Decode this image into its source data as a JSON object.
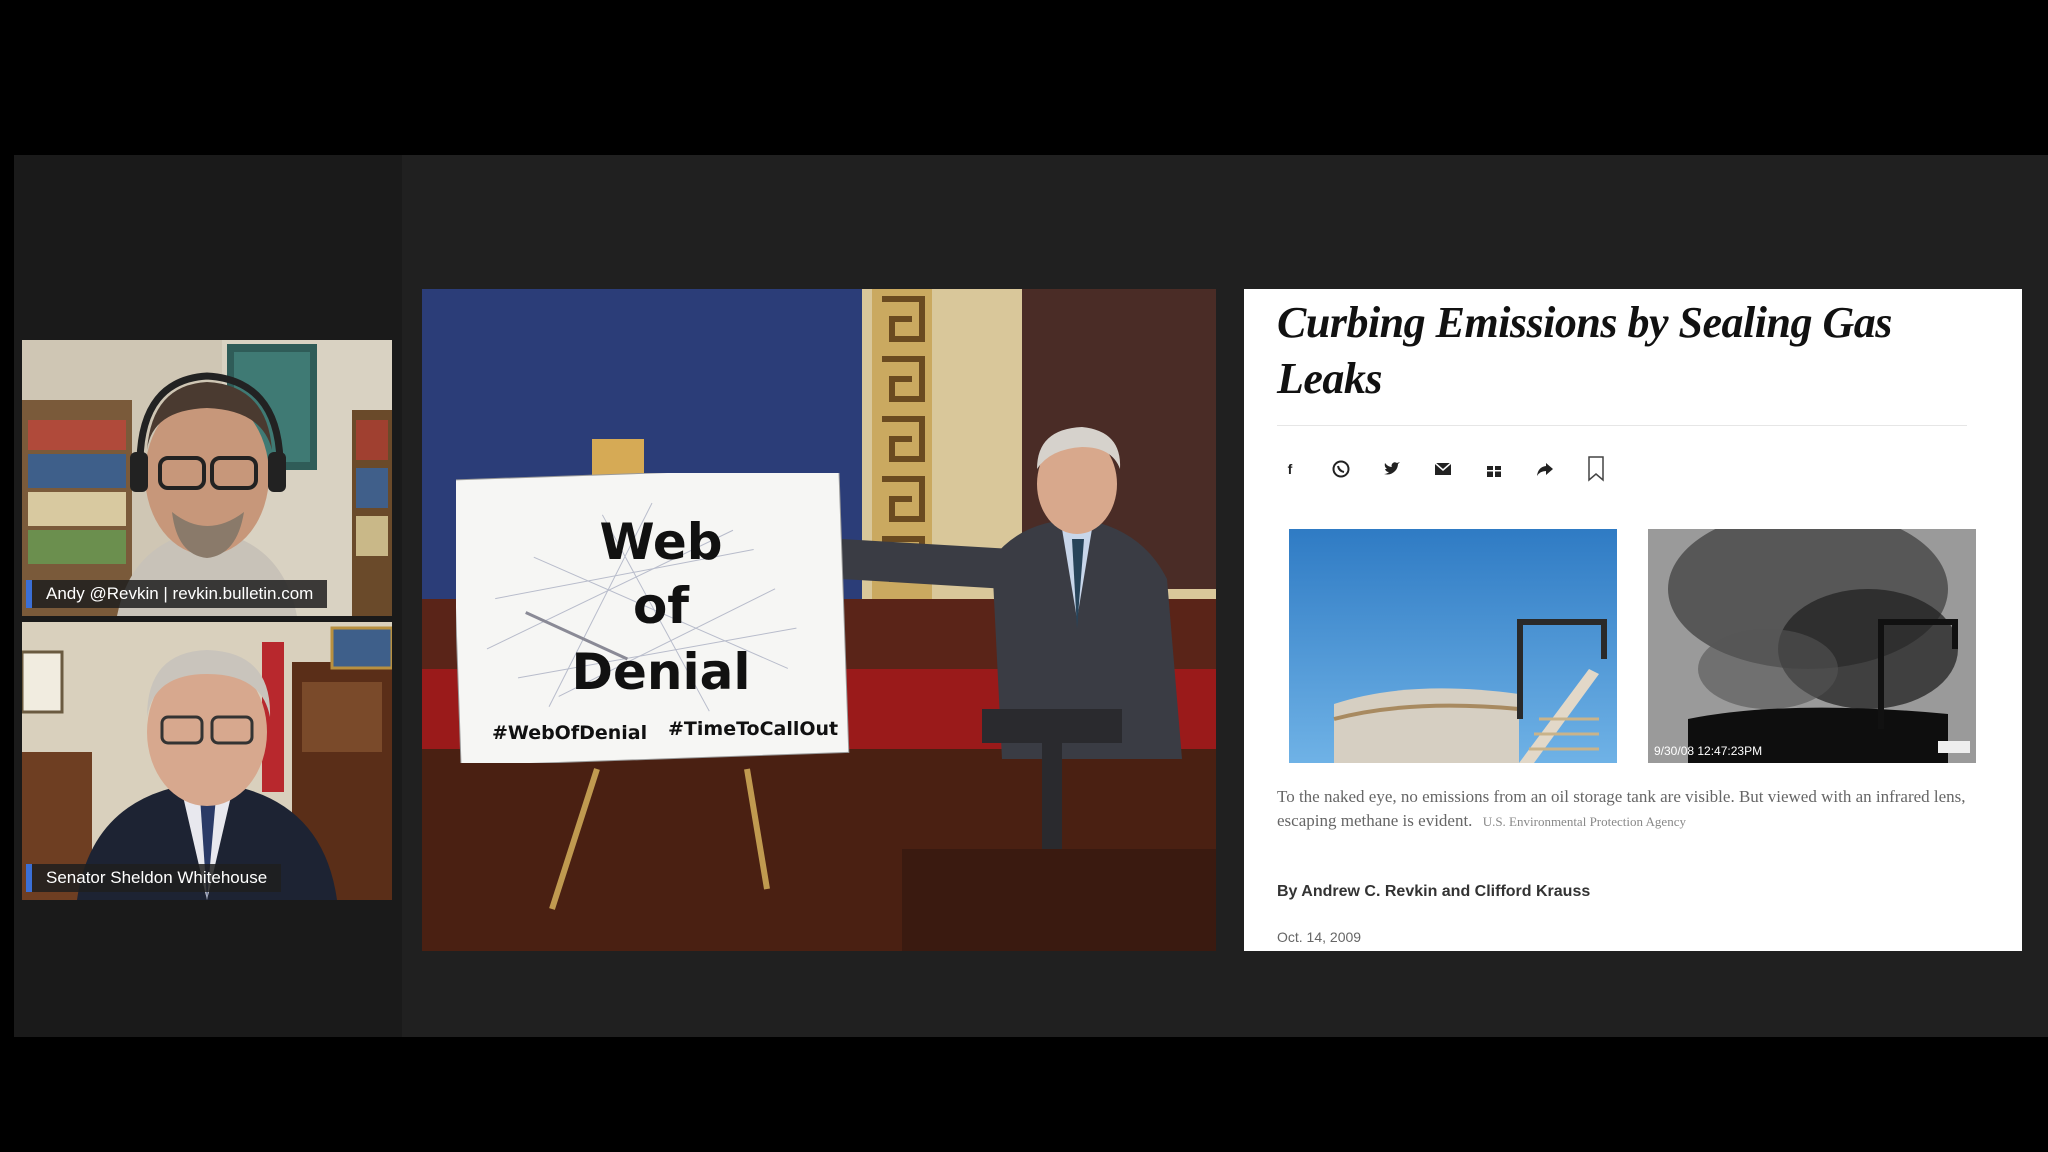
{
  "participants": [
    {
      "name": "Andy @Revkin | revkin.bulletin.com"
    },
    {
      "name": "Senator Sheldon Whitehouse"
    }
  ],
  "sign": {
    "title_line1": "Web",
    "title_line2": "of",
    "title_line3": "Denial",
    "hashtag1": "#WebOfDenial",
    "hashtag2": "#TimeToCallOut"
  },
  "article": {
    "headline": "Curbing Emissions by Sealing Gas Leaks",
    "share_icons": [
      "facebook-icon",
      "whatsapp-icon",
      "twitter-icon",
      "email-icon",
      "gift-icon",
      "share-icon",
      "bookmark-icon"
    ],
    "photo_timestamp": "9/30/08 12:47:23PM",
    "caption": "To the naked eye, no emissions from an oil storage tank are visible. But viewed with an infrared lens, escaping methane is evident.",
    "caption_credit": "U.S. Environmental Protection Agency",
    "byline": "By Andrew C. Revkin and Clifford Krauss",
    "date": "Oct. 14, 2009"
  },
  "colors": {
    "name_tag_accent": "#3b6fd6",
    "background": "#000000",
    "stage": "#202020"
  }
}
